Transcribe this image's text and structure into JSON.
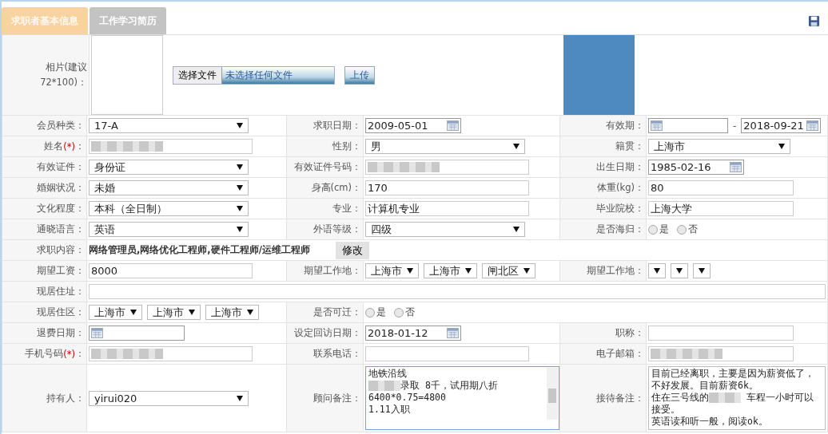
{
  "tabs": [
    {
      "label": "求职者基本信息",
      "selected": true
    },
    {
      "label": "工作学习简历",
      "selected": false
    }
  ],
  "photo": {
    "label_lines": [
      "相片(建议",
      "72*100)："
    ],
    "choose_button": "选择文件",
    "file_status": "未选择任何文件",
    "upload_button": "上传"
  },
  "rows": [
    {
      "fields": [
        {
          "label": "会员种类：",
          "kind": "select",
          "value": "17-A"
        },
        {
          "label": "求职日期：",
          "kind": "date",
          "value": "2009-05-01"
        },
        {
          "label": "有效期：",
          "kind": "date-range",
          "separator": "-",
          "to": "2018-09-21"
        }
      ]
    },
    {
      "fields": [
        {
          "label": "姓名",
          "required_mark": "(*)",
          "label_end": "：",
          "kind": "text",
          "blurred": true
        },
        {
          "label": "性别：",
          "kind": "select",
          "value": "男"
        },
        {
          "label": "籍贯：",
          "kind": "select",
          "value": "上海市"
        }
      ]
    },
    {
      "fields": [
        {
          "label": "有效证件：",
          "kind": "select",
          "value": "身份证"
        },
        {
          "label": "有效证件号码：",
          "kind": "text",
          "blurred": true
        },
        {
          "label": "出生日期：",
          "kind": "date",
          "value": "1985-02-16"
        }
      ]
    },
    {
      "fields": [
        {
          "label": "婚姻状况：",
          "kind": "select",
          "value": "未婚"
        },
        {
          "label": "身高(cm)：",
          "kind": "text",
          "value": "170"
        },
        {
          "label": "体重(kg)：",
          "kind": "text",
          "value": "80"
        }
      ]
    },
    {
      "fields": [
        {
          "label": "文化程度：",
          "kind": "select",
          "value": "本科（全日制）"
        },
        {
          "label": "专业：",
          "kind": "text",
          "value": "计算机专业"
        },
        {
          "label": "毕业院校：",
          "kind": "text",
          "value": "上海大学"
        }
      ]
    },
    {
      "fields": [
        {
          "label": "通晓语言：",
          "kind": "select",
          "value": "英语"
        },
        {
          "label": "外语等级：",
          "kind": "select",
          "value": "四级"
        },
        {
          "label": "是否海归：",
          "kind": "radio",
          "options": [
            {
              "label": "是",
              "selected": false
            },
            {
              "label": "否",
              "selected": false
            }
          ]
        }
      ]
    },
    {
      "fields": [
        {
          "label": "求职内容：",
          "kind": "jobs",
          "value": "网络管理员,网络优化工程师,硬件工程师/运维工程师",
          "button": "修改"
        }
      ]
    },
    {
      "fields": [
        {
          "label": "期望工资：",
          "kind": "text",
          "value": "8000"
        },
        {
          "label": "期望工作地：",
          "kind": "selects",
          "values": [
            {
              "kind": "select",
              "value": "上海市"
            },
            {
              "kind": "select",
              "value": "上海市"
            },
            {
              "kind": "select",
              "value": "闸北区"
            }
          ]
        },
        {
          "label": "期望工作地：",
          "kind": "selects",
          "values": [
            {
              "kind": "select"
            },
            {
              "kind": "select"
            },
            {
              "kind": "select"
            }
          ]
        }
      ]
    },
    {
      "fields": [
        {
          "label": "现居住址：",
          "kind": "text"
        }
      ]
    },
    {
      "fields": [
        {
          "label": "现居住区：",
          "kind": "selects",
          "values": [
            {
              "kind": "select",
              "value": "上海市"
            },
            {
              "kind": "select",
              "value": "上海市"
            },
            {
              "kind": "select",
              "value": "上海市"
            }
          ]
        },
        {
          "label": "是否可迁：",
          "kind": "radio",
          "options": [
            {
              "label": "是",
              "selected": false
            },
            {
              "label": "否",
              "selected": false
            }
          ]
        }
      ]
    },
    {
      "fields": [
        {
          "label": "退费日期：",
          "kind": "date"
        },
        {
          "label": "设定回访日期：",
          "kind": "date",
          "value": "2018-01-12"
        },
        {
          "label": "职称：",
          "kind": "text"
        }
      ]
    },
    {
      "fields": [
        {
          "label": "手机号码",
          "required_mark": "(*)",
          "label_end": "：",
          "kind": "text",
          "blurred": true
        },
        {
          "label": "联系电话：",
          "kind": "text"
        },
        {
          "label": "电子邮箱：",
          "kind": "text",
          "blurred": true
        }
      ]
    },
    {
      "fields": [
        {
          "label": "持有人：",
          "kind": "select",
          "value": "yirui020"
        },
        {
          "label": "顾问备注：",
          "kind": "textarea",
          "focused": true,
          "scrollbar": true,
          "lines": [
            [
              {
                "kind": "text",
                "text": "地铁沿线"
              }
            ],
            [
              {
                "kind": "blur"
              },
              {
                "kind": "text",
                "text": "录取 8千，试用期八折"
              }
            ],
            [
              {
                "kind": "text",
                "text": "6400*0.75=4800"
              }
            ],
            [
              {
                "kind": "text",
                "text": "1.11入职"
              }
            ]
          ]
        },
        {
          "label": "接待备注：",
          "kind": "textarea",
          "focused": false,
          "scrollbar": false,
          "lines": [
            [
              {
                "kind": "text",
                "text": "目前已经离职，主要是因为薪资低了，不好发展。目前薪资6k。"
              }
            ],
            [
              {
                "kind": "text",
                "text": "住在三号线的"
              },
              {
                "kind": "blur"
              },
              {
                "kind": "text",
                "text": " 车程一小时可以接受。"
              }
            ],
            [
              {
                "kind": "text",
                "text": "英语读和听一般，阅读ok。"
              }
            ]
          ]
        }
      ]
    }
  ]
}
